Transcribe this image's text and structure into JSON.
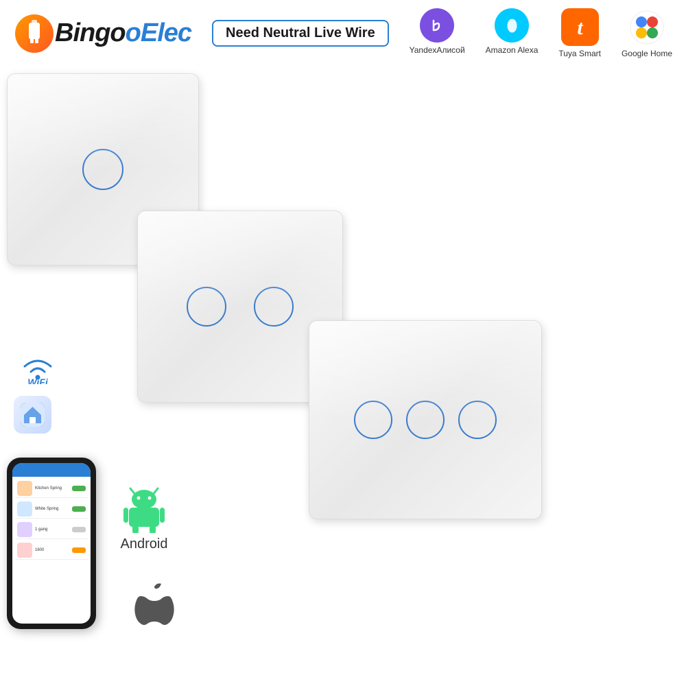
{
  "brand": {
    "name_part1": "Bingo",
    "name_part2": "Elec",
    "full_name": "BingoElec"
  },
  "header": {
    "badge_text": "Need Neutral Live Wire"
  },
  "smart_platforms": [
    {
      "id": "yandex",
      "name": "YandexАлисой",
      "icon_symbol": "◎",
      "color": "#7B4FE0"
    },
    {
      "id": "alexa",
      "name": "Amazon Alexa",
      "icon_symbol": "◎",
      "color": "#00CAFF"
    },
    {
      "id": "tuya",
      "name": "Tuya Smart",
      "icon_symbol": "t",
      "color": "#FF6600"
    },
    {
      "id": "google",
      "name": "Google Home",
      "icon_symbol": "G",
      "color": "#4285F4"
    }
  ],
  "switches": [
    {
      "id": "1gang",
      "type": "1-Gang",
      "buttons": 1
    },
    {
      "id": "2gang",
      "type": "2-Gang",
      "buttons": 2
    },
    {
      "id": "3gang",
      "type": "3-Gang",
      "buttons": 3
    }
  ],
  "connectivity": {
    "wifi_label": "WiFi",
    "android_label": "Android"
  },
  "phone_rows": [
    {
      "label": "Kitchen Spring",
      "status": "on"
    },
    {
      "label": "White Spring",
      "status": "on"
    },
    {
      "label": "1 gang",
      "status": "off"
    },
    {
      "label": "1600",
      "status": "on"
    }
  ]
}
